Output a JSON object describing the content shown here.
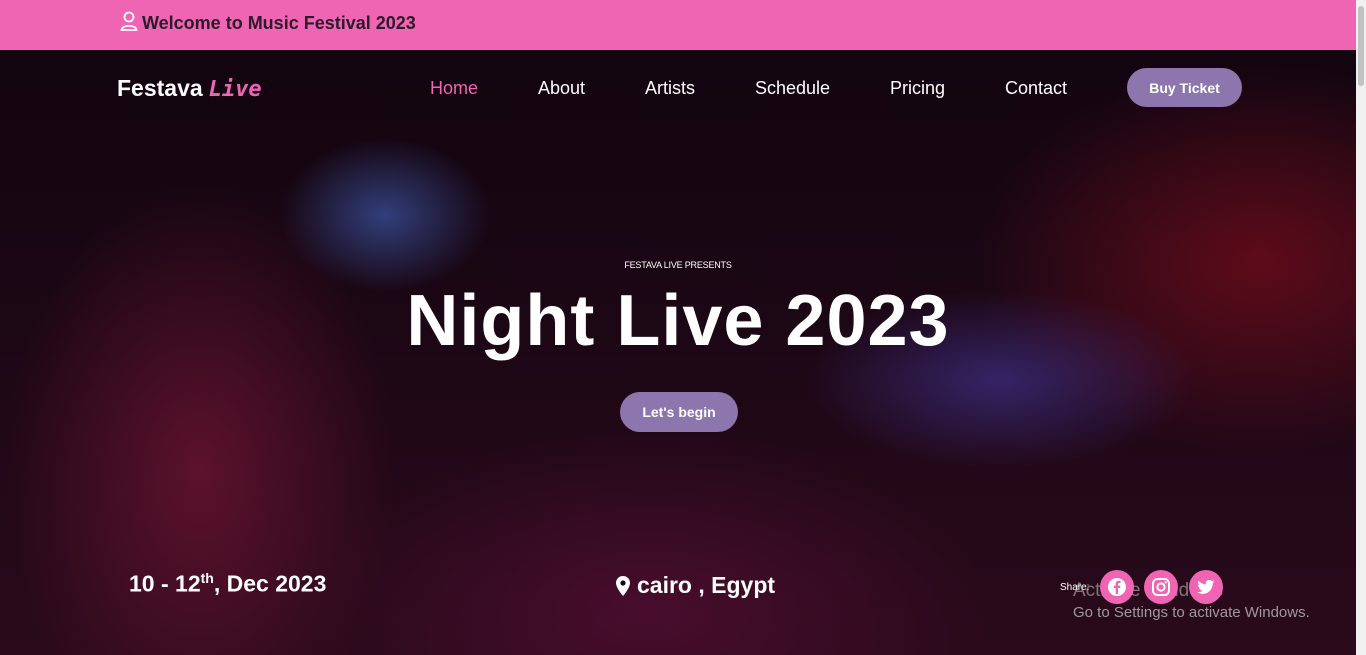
{
  "topbar": {
    "welcome": "Welcome to Music Festival 2023",
    "icon": "user-icon"
  },
  "brand": {
    "name": "Festava",
    "accent": "Live"
  },
  "nav": {
    "items": [
      {
        "label": "Home",
        "active": true
      },
      {
        "label": "About",
        "active": false
      },
      {
        "label": "Artists",
        "active": false
      },
      {
        "label": "Schedule",
        "active": false
      },
      {
        "label": "Pricing",
        "active": false
      },
      {
        "label": "Contact",
        "active": false
      }
    ],
    "cta": "Buy Ticket"
  },
  "hero": {
    "presents": "FESTAVA LIVE PRESENTS",
    "title": "Night Live 2023",
    "button": "Let's begin",
    "date_main": "10 - 12",
    "date_sup": "th",
    "date_end": ", Dec 2023",
    "location": "cairo , Egypt",
    "location_icon": "map-pin-icon"
  },
  "share": {
    "label": "Share:",
    "icons": [
      "facebook-icon",
      "instagram-icon",
      "twitter-icon"
    ]
  },
  "windows_watermark": {
    "line1": "Activate Windows",
    "line2": "Go to Settings to activate Windows."
  },
  "colors": {
    "accent_pink": "#f065b3",
    "button_purple": "#8d75ad"
  }
}
